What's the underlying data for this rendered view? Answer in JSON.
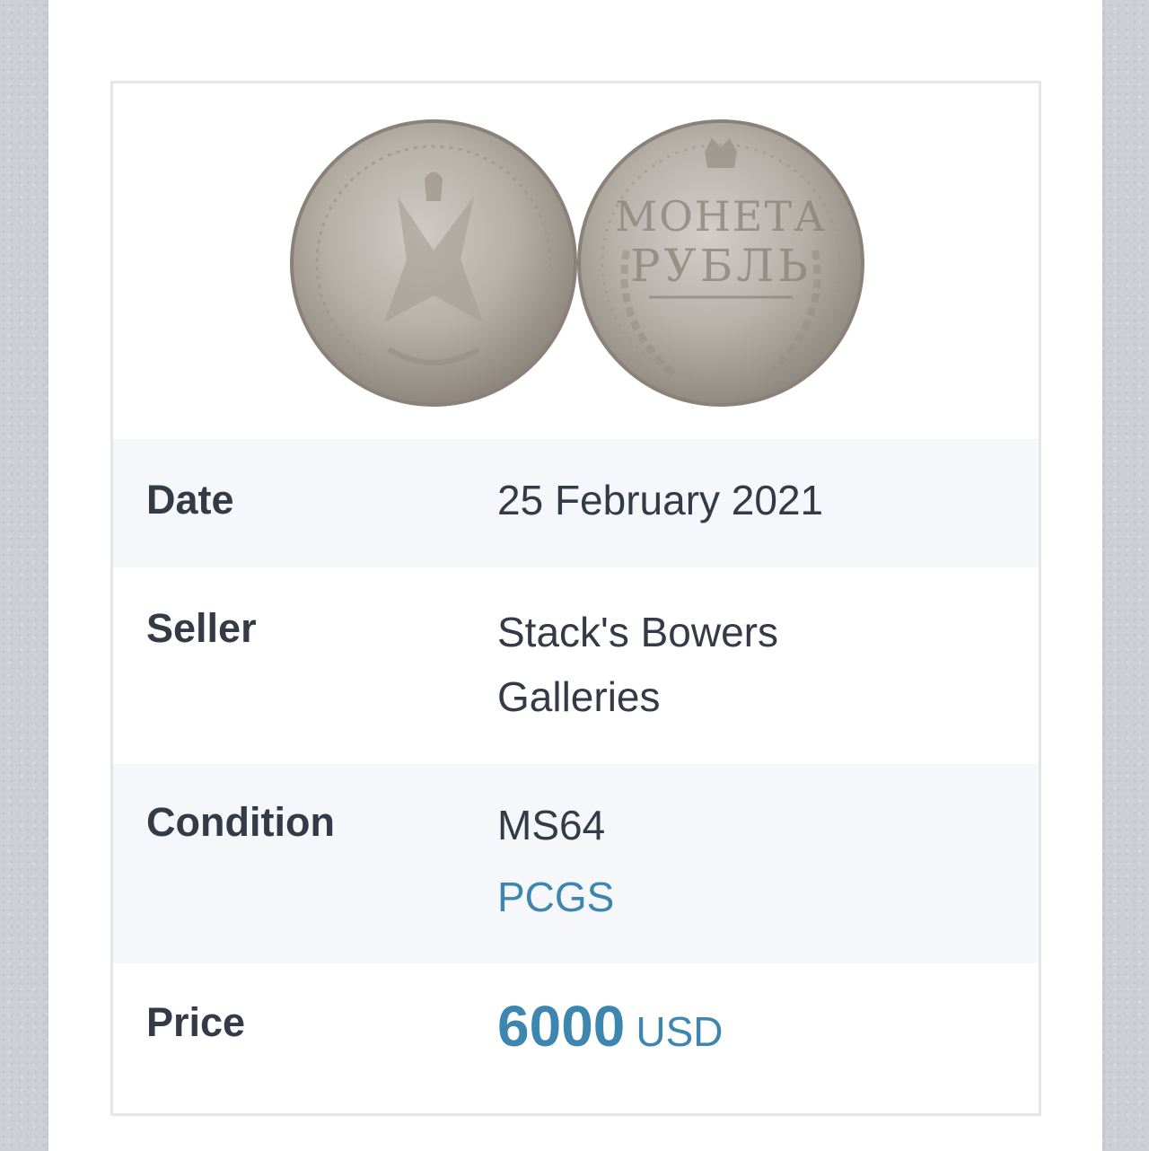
{
  "listing": {
    "coin_image_alt": "coin obverse and reverse",
    "coin_reverse_text": [
      "МОНЕТА",
      "РУБЛЬ"
    ],
    "rows": {
      "date": {
        "label": "Date",
        "value": "25 February 2021"
      },
      "seller": {
        "label": "Seller",
        "value_line1": "Stack's Bowers",
        "value_line2": "Galleries"
      },
      "condition": {
        "label": "Condition",
        "grade": "MS64",
        "grader": "PCGS"
      },
      "price": {
        "label": "Price",
        "amount": "6000",
        "currency": "USD"
      }
    }
  },
  "colors": {
    "accent_link": "#3d86b0",
    "text_dark": "#343a46",
    "row_shade": "#f5f7fa",
    "card_border": "#e3e6ea"
  }
}
